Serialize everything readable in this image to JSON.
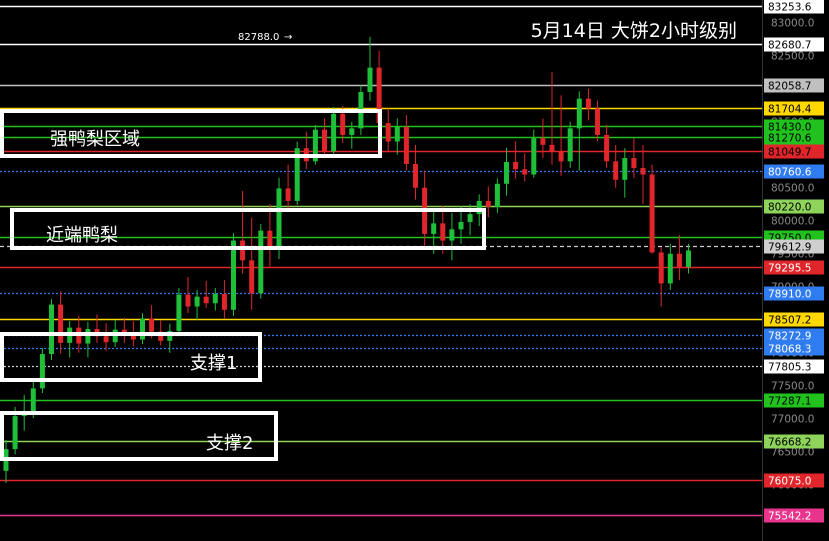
{
  "title": "5月14日 大饼2小时级别",
  "peak_annotation": "82788.0",
  "zones": {
    "strong": "强鸭梨区域",
    "near": "近端鸭梨",
    "support1": "支撑1",
    "support2": "支撑2"
  },
  "chart_data": {
    "type": "candlestick",
    "y_scale_top": 83253.6,
    "y_scale_ticks": [
      "83000.0",
      "82500.0",
      "82000.0",
      "81500.0",
      "81000.0",
      "80500.0",
      "80000.0",
      "79500.0",
      "79000.0",
      "78500.0",
      "78000.0",
      "77500.0",
      "77000.0",
      "76500.0",
      "76000.0"
    ],
    "lines": [
      {
        "price": 83253.6,
        "label": "83253.6",
        "color": "#ffffff",
        "style": "solid",
        "tag_bg": "#ffffff",
        "tag_fg": "#000000"
      },
      {
        "price": 82680.7,
        "label": "82680.7",
        "color": "#ffffff",
        "style": "solid",
        "tag_bg": "#ffffff",
        "tag_fg": "#000000"
      },
      {
        "price": 82058.7,
        "label": "82058.7",
        "color": "#c0c0c0",
        "style": "solid",
        "tag_bg": "#c0c0c0",
        "tag_fg": "#000000"
      },
      {
        "price": 81704.4,
        "label": "81704.4",
        "color": "#ffd800",
        "style": "solid",
        "tag_bg": "#ffd800",
        "tag_fg": "#000000"
      },
      {
        "price": 81430.0,
        "label": "81430.0",
        "color": "#22c21e",
        "style": "solid",
        "tag_bg": "#22c21e",
        "tag_fg": "#000000"
      },
      {
        "price": 81270.6,
        "label": "81270.6",
        "color": "#22c21e",
        "style": "solid",
        "tag_bg": "#22c21e",
        "tag_fg": "#000000"
      },
      {
        "price": 81049.7,
        "label": "81049.7",
        "color": "#e0262b",
        "style": "solid",
        "tag_bg": "#e0262b",
        "tag_fg": "#000000"
      },
      {
        "price": 80760.6,
        "label": "80760.6",
        "color": "#2f7bf0",
        "style": "dotted",
        "tag_bg": "#2f7bf0",
        "tag_fg": "#ffffff"
      },
      {
        "price": 80220.0,
        "label": "80220.0",
        "color": "#8ed45a",
        "style": "solid",
        "tag_bg": "#8ed45a",
        "tag_fg": "#000000"
      },
      {
        "price": 79750.0,
        "label": "79750.0",
        "color": "#22c21e",
        "style": "solid",
        "tag_bg": "#22c21e",
        "tag_fg": "#000000"
      },
      {
        "price": 79612.9,
        "label": "79612.9",
        "color": "#cfcfcf",
        "style": "dashed",
        "tag_bg": "#cfcfcf",
        "tag_fg": "#000000"
      },
      {
        "price": 79295.5,
        "label": "79295.5",
        "color": "#e0262b",
        "style": "solid",
        "tag_bg": "#e0262b",
        "tag_fg": "#ffffff"
      },
      {
        "price": 78910.0,
        "label": "78910.0",
        "color": "#2f7bf0",
        "style": "dotted",
        "tag_bg": "#2f7bf0",
        "tag_fg": "#ffffff"
      },
      {
        "price": 78507.2,
        "label": "78507.2",
        "color": "#ffd800",
        "style": "solid",
        "tag_bg": "#ffd800",
        "tag_fg": "#000000"
      },
      {
        "price": 78272.9,
        "label": "78272.9",
        "color": "#2f7bf0",
        "style": "dotted",
        "tag_bg": "#2f7bf0",
        "tag_fg": "#ffffff"
      },
      {
        "price": 78068.3,
        "label": "78068.3",
        "color": "#2f7bf0",
        "style": "dotted",
        "tag_bg": "#2f7bf0",
        "tag_fg": "#ffffff"
      },
      {
        "price": 77805.3,
        "label": "77805.3",
        "color": "#cfcfcf",
        "style": "dotted",
        "tag_bg": "#ffffff",
        "tag_fg": "#000000"
      },
      {
        "price": 77287.1,
        "label": "77287.1",
        "color": "#22c21e",
        "style": "solid",
        "tag_bg": "#22c21e",
        "tag_fg": "#000000"
      },
      {
        "price": 76668.2,
        "label": "76668.2",
        "color": "#8ed45a",
        "style": "solid",
        "tag_bg": "#8ed45a",
        "tag_fg": "#000000"
      },
      {
        "price": 76075.0,
        "label": "76075.0",
        "color": "#e0262b",
        "style": "solid",
        "tag_bg": "#e0262b",
        "tag_fg": "#ffffff"
      },
      {
        "price": 75542.2,
        "label": "75542.2",
        "color": "#e8348c",
        "style": "solid",
        "tag_bg": "#e8348c",
        "tag_fg": "#ffffff"
      }
    ],
    "candles": [
      [
        76210,
        76680,
        76030,
        76540
      ],
      [
        76540,
        77180,
        76460,
        77040
      ],
      [
        77040,
        77360,
        76820,
        77100
      ],
      [
        77100,
        77580,
        77010,
        77460
      ],
      [
        77460,
        78070,
        77390,
        77980
      ],
      [
        77980,
        78810,
        77890,
        78730
      ],
      [
        78730,
        78930,
        77990,
        78150
      ],
      [
        78150,
        78480,
        77930,
        78380
      ],
      [
        78380,
        78560,
        78000,
        78140
      ],
      [
        78140,
        78470,
        77930,
        78360
      ],
      [
        78360,
        78580,
        78150,
        78250
      ],
      [
        78250,
        78450,
        78030,
        78160
      ],
      [
        78160,
        78500,
        78090,
        78350
      ],
      [
        78350,
        78530,
        78150,
        78280
      ],
      [
        78280,
        78480,
        78100,
        78200
      ],
      [
        78200,
        78600,
        78130,
        78520
      ],
      [
        78520,
        78720,
        78220,
        78320
      ],
      [
        78320,
        78490,
        78110,
        78180
      ],
      [
        78180,
        78440,
        78000,
        78330
      ],
      [
        78330,
        78980,
        78250,
        78880
      ],
      [
        78880,
        79150,
        78600,
        78700
      ],
      [
        78700,
        78950,
        78500,
        78850
      ],
      [
        78850,
        79090,
        78680,
        78750
      ],
      [
        78750,
        78980,
        78640,
        78890
      ],
      [
        78890,
        79100,
        78520,
        78650
      ],
      [
        78650,
        79810,
        78560,
        79700
      ],
      [
        79700,
        80450,
        79200,
        79400
      ],
      [
        79400,
        80050,
        78650,
        78900
      ],
      [
        78900,
        79950,
        78820,
        79850
      ],
      [
        79850,
        80250,
        79300,
        79560
      ],
      [
        79560,
        80650,
        79420,
        80490
      ],
      [
        80490,
        80850,
        80180,
        80300
      ],
      [
        80300,
        81200,
        80240,
        81100
      ],
      [
        81100,
        81350,
        80780,
        80900
      ],
      [
        80900,
        81450,
        80850,
        81380
      ],
      [
        81380,
        81550,
        80950,
        81050
      ],
      [
        81050,
        81720,
        80980,
        81620
      ],
      [
        81620,
        81740,
        81180,
        81300
      ],
      [
        81300,
        81500,
        81090,
        81400
      ],
      [
        81400,
        82050,
        81300,
        81950
      ],
      [
        81950,
        82788,
        81820,
        82320
      ],
      [
        82320,
        82580,
        81240,
        81480
      ],
      [
        81480,
        81700,
        81050,
        81200
      ],
      [
        81200,
        81550,
        81000,
        81420
      ],
      [
        81420,
        81600,
        80760,
        80860
      ],
      [
        80860,
        81150,
        80320,
        80500
      ],
      [
        80500,
        80760,
        79600,
        79800
      ],
      [
        79800,
        80150,
        79500,
        79960
      ],
      [
        79960,
        80220,
        79500,
        79700
      ],
      [
        79700,
        80120,
        79400,
        79870
      ],
      [
        79870,
        80220,
        79650,
        79980
      ],
      [
        79980,
        80250,
        79780,
        80100
      ],
      [
        80100,
        80400,
        79920,
        80300
      ],
      [
        80300,
        80520,
        80050,
        80210
      ],
      [
        80210,
        80640,
        80120,
        80560
      ],
      [
        80560,
        81100,
        80380,
        80890
      ],
      [
        80890,
        81200,
        80640,
        80780
      ],
      [
        80780,
        81020,
        80600,
        80700
      ],
      [
        80700,
        81380,
        80650,
        81250
      ],
      [
        81250,
        81550,
        80950,
        81150
      ],
      [
        81150,
        82250,
        80850,
        81050
      ],
      [
        81050,
        81900,
        80680,
        80900
      ],
      [
        80900,
        81500,
        80800,
        81400
      ],
      [
        81400,
        81960,
        80760,
        81850
      ],
      [
        81850,
        82000,
        81520,
        81700
      ],
      [
        81700,
        81820,
        81200,
        81300
      ],
      [
        81300,
        81450,
        80800,
        80900
      ],
      [
        80900,
        81150,
        80500,
        80620
      ],
      [
        80620,
        81100,
        80350,
        80950
      ],
      [
        80950,
        81250,
        80650,
        80800
      ],
      [
        80800,
        81150,
        80250,
        80700
      ],
      [
        80700,
        80850,
        79500,
        79520
      ],
      [
        79520,
        79600,
        78700,
        79050
      ],
      [
        79050,
        79650,
        78950,
        79500
      ],
      [
        79500,
        79780,
        79100,
        79300
      ],
      [
        79300,
        79650,
        79200,
        79550
      ]
    ]
  }
}
